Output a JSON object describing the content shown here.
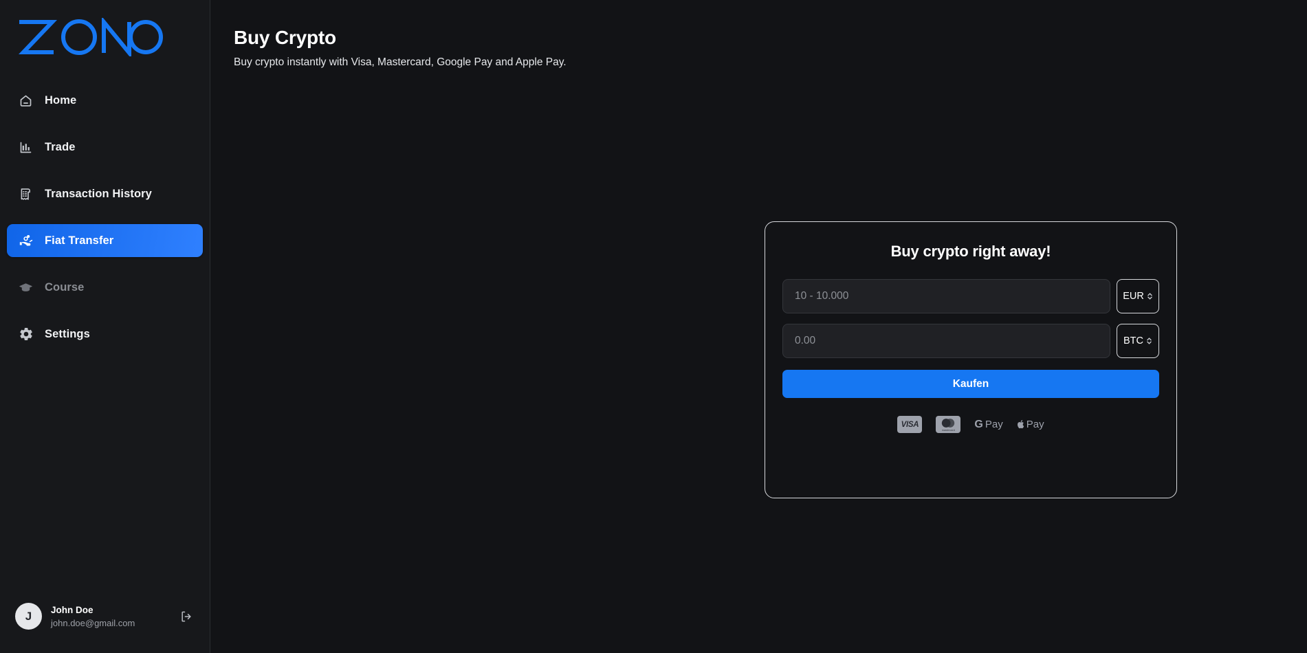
{
  "brand": {
    "logo_text": "ZONO",
    "logo_color": "#1677f2"
  },
  "sidebar": {
    "items": [
      {
        "label": "Home",
        "icon": "home-icon",
        "state": "default"
      },
      {
        "label": "Trade",
        "icon": "bar-chart-icon",
        "state": "default"
      },
      {
        "label": "Transaction History",
        "icon": "receipt-icon",
        "state": "default"
      },
      {
        "label": "Fiat Transfer",
        "icon": "hand-coins-icon",
        "state": "active"
      },
      {
        "label": "Course",
        "icon": "graduation-cap-icon",
        "state": "muted"
      },
      {
        "label": "Settings",
        "icon": "gear-icon",
        "state": "default"
      }
    ],
    "user": {
      "avatar_initial": "J",
      "name": "John Doe",
      "email": "john.doe@gmail.com",
      "logout_icon": "logout-icon"
    }
  },
  "header": {
    "title": "Buy Crypto",
    "subtitle": "Buy crypto instantly with Visa, Mastercard, Google Pay and Apple Pay."
  },
  "buy_card": {
    "title": "Buy crypto right away!",
    "fiat_field": {
      "placeholder": "10 - 10.000",
      "value": ""
    },
    "fiat_currency": "EUR",
    "crypto_field": {
      "placeholder": "0.00",
      "value": ""
    },
    "crypto_currency": "BTC",
    "submit_label": "Kaufen",
    "payment_methods": [
      {
        "name": "visa",
        "label": "VISA"
      },
      {
        "name": "mastercard",
        "label": "mastercard"
      },
      {
        "name": "google-pay",
        "label": "Pay",
        "mark": "G"
      },
      {
        "name": "apple-pay",
        "label": "Pay",
        "mark": ""
      }
    ]
  },
  "colors": {
    "accent": "#1677f2",
    "page_bg": "#121316",
    "sidebar_bg": "#17181b",
    "card_border": "#d8dade",
    "muted_text": "#8a8d93"
  }
}
